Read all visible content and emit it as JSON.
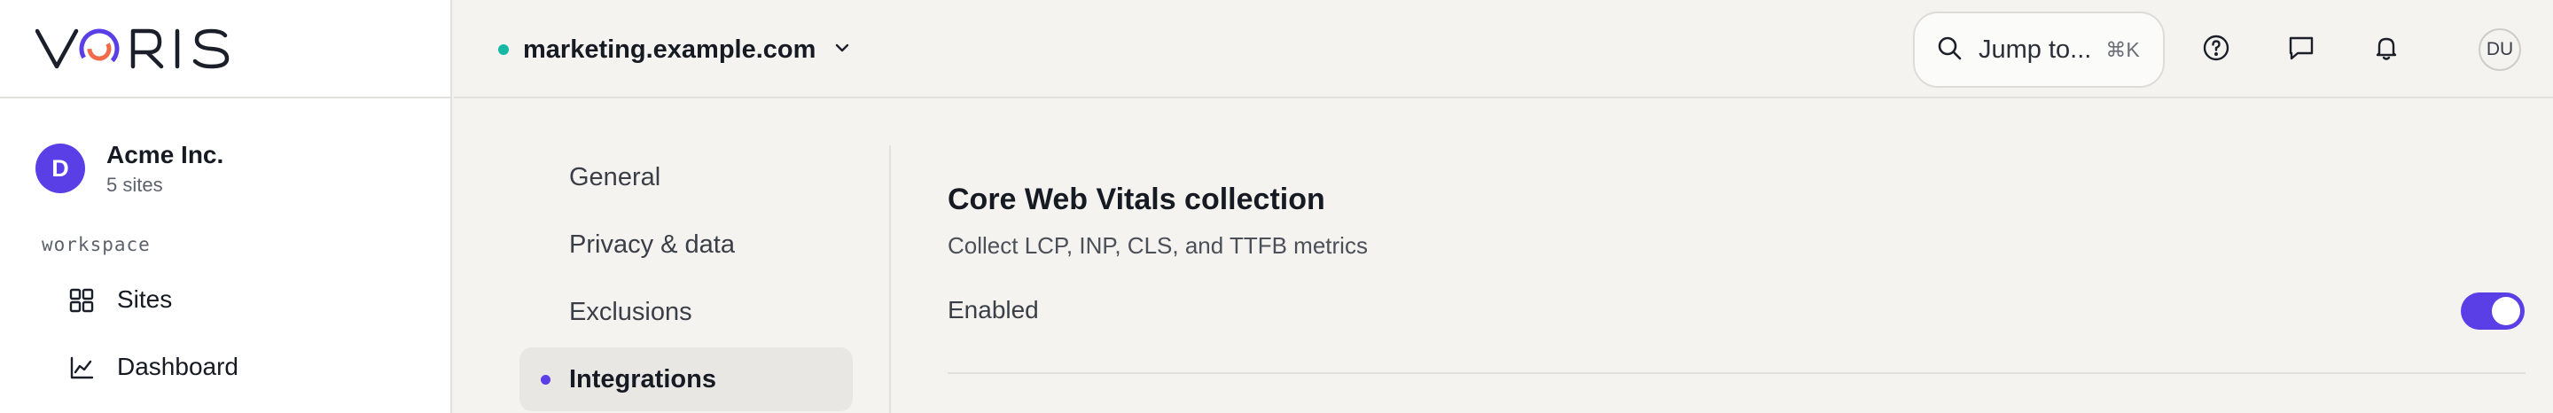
{
  "brand": {
    "name": "VORIS",
    "logo_icon": "voris-logo",
    "accent": "#5b3fe6",
    "ring_secondary": "#f06b4a"
  },
  "org": {
    "initial": "D",
    "name": "Acme Inc.",
    "subtitle": "5 sites"
  },
  "sidebar": {
    "section_label": "workspace",
    "items": [
      {
        "label": "Sites",
        "icon": "grid-icon"
      },
      {
        "label": "Dashboard",
        "icon": "chart-line-icon"
      }
    ]
  },
  "topbar": {
    "site": {
      "name": "marketing.example.com",
      "status_color": "#16b8a5"
    },
    "search": {
      "label": "Jump to...",
      "shortcut": "⌘K"
    },
    "icons": [
      "help-icon",
      "message-icon",
      "bell-icon"
    ],
    "user_initials": "DU"
  },
  "settings_nav": {
    "items": [
      {
        "label": "General",
        "active": false
      },
      {
        "label": "Privacy & data",
        "active": false
      },
      {
        "label": "Exclusions",
        "active": false
      },
      {
        "label": "Integrations",
        "active": true
      }
    ]
  },
  "setting": {
    "title": "Core Web Vitals collection",
    "description": "Collect LCP, INP, CLS, and TTFB metrics",
    "toggle_label": "Enabled",
    "toggle_on": true
  }
}
